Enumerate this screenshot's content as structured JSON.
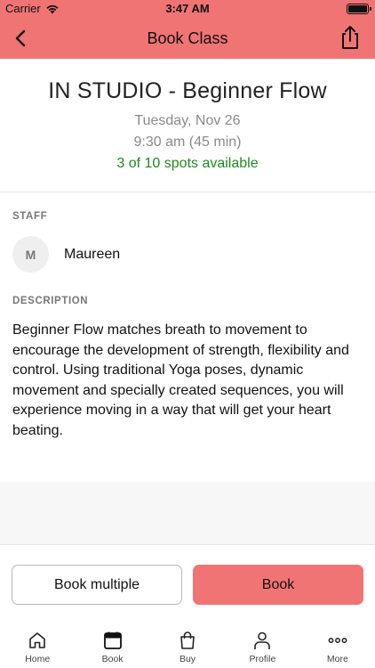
{
  "status_bar": {
    "carrier": "Carrier",
    "time": "3:47 AM"
  },
  "nav": {
    "title": "Book Class",
    "back_icon": "chevron-left-icon",
    "share_icon": "share-icon"
  },
  "class_info": {
    "title": "IN STUDIO - Beginner Flow",
    "date": "Tuesday, Nov 26",
    "time": "9:30 am (45 min)",
    "spots": "3 of 10 spots available"
  },
  "staff": {
    "label": "STAFF",
    "initial": "M",
    "name": "Maureen"
  },
  "description": {
    "label": "DESCRIPTION",
    "text": "Beginner Flow matches breath to movement to encourage the development of strength, flexibility and control. Using traditional Yoga poses, dynamic movement and specially created sequences, you will experience moving in a way that will get your heart beating."
  },
  "actions": {
    "book_multiple": "Book multiple",
    "book": "Book"
  },
  "tabs": [
    {
      "label": "Home",
      "icon": "home-icon"
    },
    {
      "label": "Book",
      "icon": "calendar-icon"
    },
    {
      "label": "Buy",
      "icon": "shopping-bag-icon"
    },
    {
      "label": "Profile",
      "icon": "person-icon"
    },
    {
      "label": "More",
      "icon": "more-icon"
    }
  ],
  "colors": {
    "accent": "#f07474",
    "spots_green": "#1e8a1e",
    "muted": "#8a8a8a"
  }
}
